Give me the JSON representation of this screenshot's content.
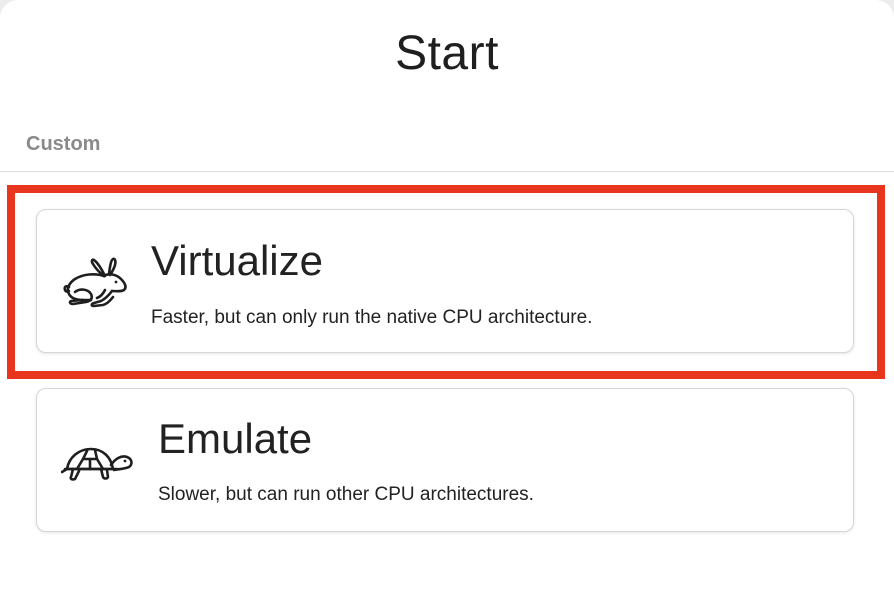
{
  "window": {
    "title": "Start"
  },
  "section": {
    "header": "Custom"
  },
  "options": [
    {
      "title": "Virtualize",
      "description": "Faster, but can only run the native CPU architecture.",
      "icon": "rabbit-icon",
      "highlighted": true
    },
    {
      "title": "Emulate",
      "description": "Slower, but can run other CPU architectures.",
      "icon": "turtle-icon",
      "highlighted": false
    }
  ],
  "colors": {
    "highlight": "#e8351e",
    "section_header": "#8a8a8a",
    "text": "#222222"
  }
}
